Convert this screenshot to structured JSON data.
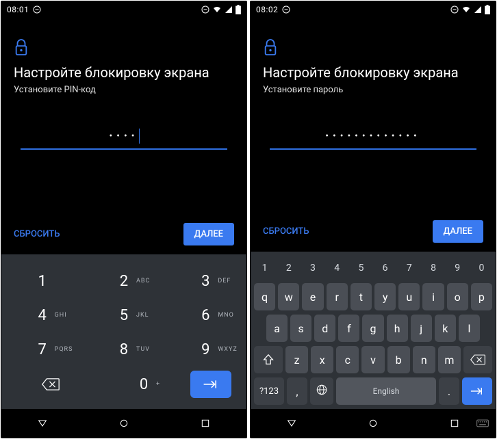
{
  "left": {
    "status": {
      "time": "08:01"
    },
    "title": "Настройте блокировку экрана",
    "subtitle": "Установите PIN-код",
    "input_mask": "••••",
    "clear_label": "СБРОСИТЬ",
    "next_label": "ДАЛЕЕ",
    "numpad": {
      "k1": {
        "d": "1",
        "s": ""
      },
      "k2": {
        "d": "2",
        "s": "ABC"
      },
      "k3": {
        "d": "3",
        "s": "DEF"
      },
      "k4": {
        "d": "4",
        "s": "GHI"
      },
      "k5": {
        "d": "5",
        "s": "JKL"
      },
      "k6": {
        "d": "6",
        "s": "MNO"
      },
      "k7": {
        "d": "7",
        "s": "PQRS"
      },
      "k8": {
        "d": "8",
        "s": "TUV"
      },
      "k9": {
        "d": "9",
        "s": "WXYZ"
      },
      "k0": {
        "d": "0",
        "s": "+"
      }
    }
  },
  "right": {
    "status": {
      "time": "08:02"
    },
    "title": "Настройте блокировку экрана",
    "subtitle": "Установите пароль",
    "input_mask": "•••••••••••••",
    "clear_label": "СБРОСИТЬ",
    "next_label": "ДАЛЕЕ",
    "qwerty": {
      "numrow": [
        "1",
        "2",
        "3",
        "4",
        "5",
        "6",
        "7",
        "8",
        "9",
        "0"
      ],
      "row1": [
        "q",
        "w",
        "e",
        "r",
        "t",
        "y",
        "u",
        "i",
        "o",
        "p"
      ],
      "row2": [
        "a",
        "s",
        "d",
        "f",
        "g",
        "h",
        "j",
        "k",
        "l"
      ],
      "row3": [
        "z",
        "x",
        "c",
        "v",
        "b",
        "n",
        "m"
      ],
      "sym": "?123",
      "comma": ",",
      "space": "English",
      "period": "."
    }
  }
}
